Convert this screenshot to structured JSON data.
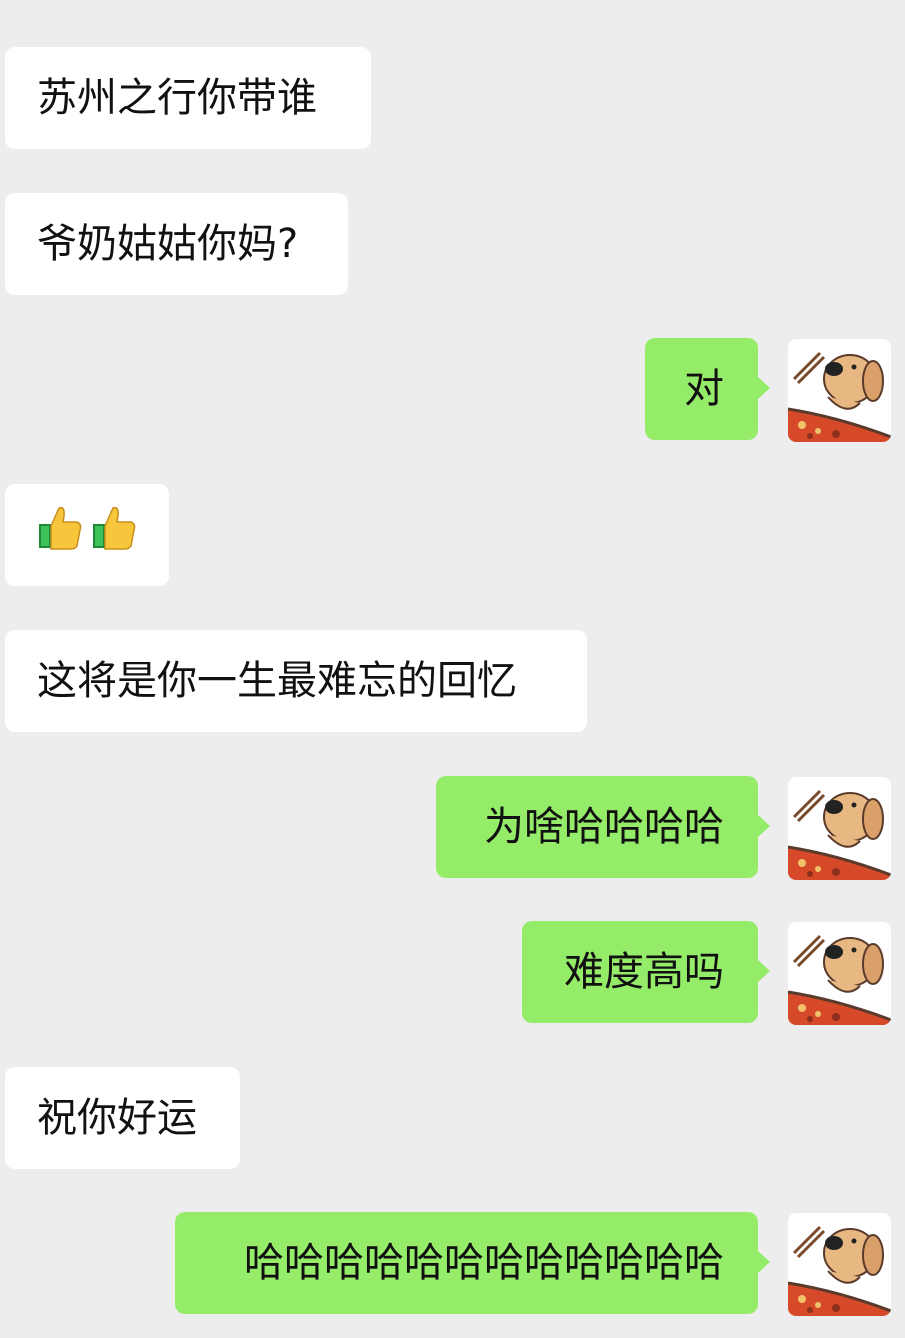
{
  "messages": [
    {
      "side": "in",
      "text": "苏州之行你带谁"
    },
    {
      "side": "in",
      "text": "爷奶姑姑你妈?"
    },
    {
      "side": "out",
      "text": "对",
      "avatar": "dog-eating-pizza-avatar"
    },
    {
      "side": "in",
      "text": "",
      "emoji": [
        "thumbs-up-icon",
        "thumbs-up-icon"
      ]
    },
    {
      "side": "in",
      "text": "这将是你一生最难忘的回忆"
    },
    {
      "side": "out",
      "text": "为啥哈哈哈哈",
      "avatar": "dog-eating-pizza-avatar"
    },
    {
      "side": "out",
      "text": "难度高吗",
      "avatar": "dog-eating-pizza-avatar"
    },
    {
      "side": "in",
      "text": "祝你好运"
    },
    {
      "side": "out",
      "text": "哈哈哈哈哈哈哈哈哈哈哈哈",
      "avatar": "dog-eating-pizza-avatar"
    }
  ],
  "colors": {
    "background": "#ededed",
    "incoming": "#ffffff",
    "outgoing": "#95ec69"
  }
}
